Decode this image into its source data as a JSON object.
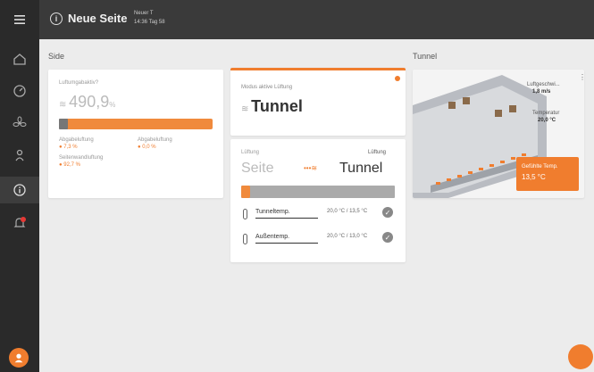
{
  "topbar": {
    "title": "Neue Seite",
    "meta_line1": "Neuer T",
    "meta_line2": "14:36 Tag 58"
  },
  "sections": {
    "side": "Side",
    "tunnel": "Tunnel"
  },
  "card_side": {
    "label": "Luftumgabaktiv?",
    "value": "490,9",
    "unit": "%",
    "progress_fraction": 0.06,
    "stat1_label": "Abgabeluftung",
    "stat1_value": "7,3 %",
    "stat2_label": "Abgabeluftung",
    "stat2_value": "0,0 %",
    "stat3_label": "Seitenwandluftung",
    "stat3_value": "92,7 %"
  },
  "card_mode": {
    "label": "Modus aktive Lüftung",
    "value": "Tunnel"
  },
  "card_transition": {
    "left_small": "Lüftung",
    "right_small": "Lüftung",
    "left_big": "Seite",
    "right_big": "Tunnel",
    "progress_fraction": 0.06,
    "rows": [
      {
        "label": "Tunneltemp.",
        "value": "20,0 °C / 13,5 °C"
      },
      {
        "label": "Außentemp.",
        "value": "20,0 °C / 13,0 °C"
      }
    ]
  },
  "card_tunnel_image": {
    "label1": "Luftgeschwi...",
    "value1": "1,8 m/s",
    "label2": "Temperatur",
    "value2": "20,0 °C",
    "badge_label": "Gefühlte Temp.",
    "badge_value": "13,5 °C",
    "menu": "⋮"
  },
  "colors": {
    "accent": "#f07d2e",
    "sidebar": "#2a2a2a",
    "topbar": "#3a3a3a",
    "background": "#ececec"
  },
  "icons": [
    "menu-icon",
    "home-icon",
    "gauge-icon",
    "fan-icon",
    "person-icon",
    "info-icon",
    "notification-icon"
  ]
}
